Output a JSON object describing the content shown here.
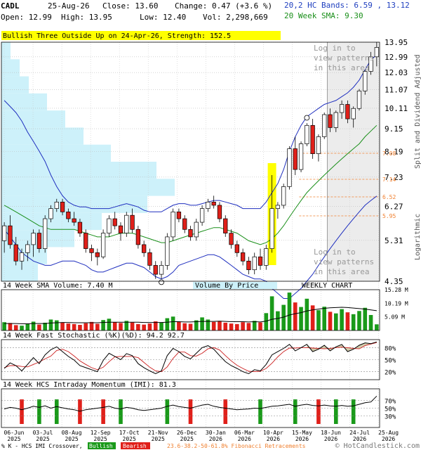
{
  "header": {
    "symbol": "CADL",
    "date": "25-Aug-26",
    "close": "Close: 13.60",
    "change": "Change: 0.47 (+3.6 %)",
    "open": "Open: 12.99",
    "high": "High: 13.95",
    "low": "Low: 12.40",
    "volume": "Vol: 2,298,669",
    "bands": "20,2 HC Bands: 6.59 , 13.12",
    "sma": "20 Week SMA: 9.30"
  },
  "banner": "Bullish Three Outside Up on 24-Apr-26, Strength: 152.5",
  "watermark": [
    "Log in to",
    "view patterns",
    "in this area"
  ],
  "colors": {
    "up": "#1a9a1a",
    "down": "#e0201a",
    "band": "#1f2fbf",
    "sma": "#1a8f1a",
    "vbp": "#cdf1fa",
    "highlight": "#ffff00",
    "shade": "#ececec",
    "fib": "#f08030"
  },
  "price_axis": {
    "labels": [
      "13.95",
      "12.99",
      "12.03",
      "11.07",
      "10.11",
      "9.15",
      "8.19",
      "7.23",
      "6.27",
      "5.31",
      "4.35"
    ],
    "title": "Split and Dividend Adjusted",
    "scale": "Logarithmic"
  },
  "fib_levels": [
    "7.08",
    "7.14",
    "6.52",
    "5.95"
  ],
  "panel_titles": {
    "volume": "14 Week SMA Volume: 7.40 M",
    "vbp": "Volume By Price",
    "weekly": "WEEKLY CHART",
    "stoch": "14 Week Fast Stochastic (%K)(%D): 94.2 92.7",
    "imi": "14 Week HCS Intraday Momentum (IMI): 81.3"
  },
  "volume_axis": [
    "15.28 M",
    "10.19 M",
    "5.09 M"
  ],
  "stoch_axis": [
    "80%",
    "50%",
    "20%"
  ],
  "imi_axis": [
    "70%",
    "50%",
    "30%"
  ],
  "x_labels": [
    [
      "06-Jun",
      "2025"
    ],
    [
      "03-Jul",
      "2025"
    ],
    [
      "08-Aug",
      "2025"
    ],
    [
      "12-Sep",
      "2025"
    ],
    [
      "17-Oct",
      "2025"
    ],
    [
      "21-Nov",
      "2025"
    ],
    [
      "26-Dec",
      "2025"
    ],
    [
      "30-Jan",
      "2026"
    ],
    [
      "06-Mar",
      "2026"
    ],
    [
      "10-Apr",
      "2026"
    ],
    [
      "15-May",
      "2026"
    ],
    [
      "18-Jun",
      "2026"
    ],
    [
      "24-Jul",
      "2026"
    ],
    [
      "25-Aug",
      "2026"
    ]
  ],
  "footer": {
    "prefix": "% K - HCS IMI Crossover,",
    "bullish": "Bullish",
    "bearish": "Bearish",
    "fib": "23.6-38.2-50-61.8% Fibonacci Retracements",
    "credit": "© HotCandlestick.com"
  },
  "chart_data": {
    "type": "candlestick",
    "title": "CADL",
    "ylim": [
      4.35,
      13.95
    ],
    "log_scale": true,
    "weeks": 65,
    "ohlc": [
      [
        5.3,
        5.8,
        5.0,
        5.7
      ],
      [
        5.7,
        6.0,
        5.1,
        5.2
      ],
      [
        5.2,
        5.4,
        4.7,
        4.8
      ],
      [
        4.8,
        5.1,
        4.6,
        5.0
      ],
      [
        5.0,
        5.3,
        4.8,
        5.2
      ],
      [
        5.2,
        5.6,
        4.9,
        5.5
      ],
      [
        5.5,
        5.6,
        5.0,
        5.1
      ],
      [
        5.1,
        6.0,
        5.0,
        5.9
      ],
      [
        5.9,
        6.3,
        5.8,
        6.2
      ],
      [
        6.2,
        6.5,
        6.1,
        6.4
      ],
      [
        6.4,
        6.5,
        6.0,
        6.1
      ],
      [
        6.1,
        6.2,
        5.8,
        5.9
      ],
      [
        5.9,
        6.1,
        5.7,
        5.8
      ],
      [
        5.8,
        5.9,
        5.4,
        5.5
      ],
      [
        5.5,
        5.6,
        5.0,
        5.1
      ],
      [
        5.1,
        5.2,
        4.8,
        5.0
      ],
      [
        5.0,
        5.1,
        4.7,
        4.9
      ],
      [
        4.9,
        5.6,
        4.85,
        5.5
      ],
      [
        5.5,
        6.0,
        5.4,
        5.9
      ],
      [
        5.9,
        6.1,
        5.6,
        5.7
      ],
      [
        5.7,
        5.8,
        5.3,
        5.5
      ],
      [
        5.5,
        6.1,
        5.4,
        6.0
      ],
      [
        6.0,
        6.2,
        5.5,
        5.6
      ],
      [
        5.6,
        5.7,
        5.1,
        5.2
      ],
      [
        5.2,
        5.3,
        4.9,
        5.0
      ],
      [
        5.0,
        5.1,
        4.6,
        4.7
      ],
      [
        4.7,
        4.8,
        4.4,
        4.5
      ],
      [
        4.5,
        4.8,
        4.4,
        4.7
      ],
      [
        4.7,
        5.5,
        4.6,
        5.4
      ],
      [
        5.4,
        6.2,
        5.3,
        6.1
      ],
      [
        6.1,
        6.2,
        5.8,
        5.9
      ],
      [
        5.9,
        6.0,
        5.5,
        5.6
      ],
      [
        5.6,
        5.7,
        5.3,
        5.4
      ],
      [
        5.4,
        5.9,
        5.3,
        5.8
      ],
      [
        5.8,
        6.3,
        5.7,
        6.2
      ],
      [
        6.2,
        6.5,
        6.1,
        6.4
      ],
      [
        6.4,
        6.6,
        6.2,
        6.3
      ],
      [
        6.3,
        6.4,
        5.8,
        5.9
      ],
      [
        5.9,
        6.0,
        5.4,
        5.5
      ],
      [
        5.5,
        5.6,
        5.1,
        5.2
      ],
      [
        5.2,
        5.3,
        4.9,
        5.0
      ],
      [
        5.0,
        5.1,
        4.7,
        4.8
      ],
      [
        4.8,
        4.9,
        4.5,
        4.6
      ],
      [
        4.6,
        5.0,
        4.5,
        4.9
      ],
      [
        4.9,
        5.1,
        4.6,
        4.7
      ],
      [
        4.7,
        5.2,
        4.6,
        5.1
      ],
      [
        5.1,
        7.3,
        5.0,
        6.2
      ],
      [
        6.2,
        6.4,
        5.9,
        6.3
      ],
      [
        6.3,
        7.0,
        6.2,
        6.9
      ],
      [
        6.9,
        8.4,
        6.8,
        8.3
      ],
      [
        8.3,
        8.8,
        7.3,
        7.5
      ],
      [
        7.5,
        8.6,
        7.4,
        8.5
      ],
      [
        8.5,
        9.4,
        8.4,
        9.3
      ],
      [
        9.3,
        9.6,
        7.9,
        8.1
      ],
      [
        8.1,
        8.9,
        7.8,
        8.8
      ],
      [
        8.8,
        9.9,
        8.7,
        9.8
      ],
      [
        9.8,
        10.1,
        9.0,
        9.2
      ],
      [
        9.2,
        10.0,
        9.0,
        9.9
      ],
      [
        9.9,
        10.5,
        9.6,
        10.3
      ],
      [
        10.3,
        10.5,
        9.4,
        9.6
      ],
      [
        9.6,
        10.2,
        9.2,
        10.1
      ],
      [
        10.1,
        11.1,
        10.0,
        11.0
      ],
      [
        11.0,
        12.2,
        10.8,
        12.1
      ],
      [
        12.1,
        13.3,
        11.9,
        12.99
      ],
      [
        12.99,
        13.95,
        12.4,
        13.6
      ]
    ],
    "volume_millions": [
      3.1,
      2.8,
      2.0,
      1.8,
      2.5,
      3.3,
      2.2,
      2.9,
      4.1,
      3.8,
      3.0,
      2.6,
      2.4,
      2.1,
      2.7,
      3.2,
      2.5,
      3.9,
      4.4,
      3.1,
      2.8,
      3.6,
      3.0,
      2.4,
      2.2,
      2.6,
      3.4,
      2.9,
      4.6,
      5.2,
      3.3,
      2.7,
      2.5,
      3.8,
      4.9,
      4.1,
      3.2,
      3.5,
      2.9,
      2.6,
      2.4,
      3.1,
      2.8,
      3.6,
      3.0,
      6.5,
      12.8,
      7.2,
      9.6,
      14.2,
      10.5,
      8.8,
      11.9,
      9.4,
      7.6,
      8.9,
      7.0,
      6.4,
      8.0,
      6.8,
      6.1,
      7.3,
      8.5,
      5.8,
      2.3
    ],
    "volume_sma": [
      2.6,
      2.6,
      2.6,
      2.5,
      2.5,
      2.6,
      2.6,
      2.6,
      2.8,
      2.9,
      3.0,
      3.0,
      2.9,
      2.9,
      2.9,
      2.9,
      2.9,
      3.0,
      3.1,
      3.1,
      3.1,
      3.1,
      3.1,
      3.1,
      3.0,
      3.0,
      3.0,
      3.0,
      3.1,
      3.3,
      3.3,
      3.2,
      3.2,
      3.3,
      3.4,
      3.4,
      3.4,
      3.5,
      3.4,
      3.3,
      3.3,
      3.3,
      3.2,
      3.3,
      3.2,
      3.5,
      4.2,
      4.5,
      5.0,
      5.8,
      6.3,
      6.7,
      7.3,
      7.7,
      8.0,
      8.3,
      8.5,
      8.6,
      8.7,
      8.6,
      8.4,
      8.2,
      8.0,
      7.7,
      7.4
    ],
    "stochastic_k": [
      28,
      42,
      35,
      22,
      38,
      55,
      40,
      62,
      75,
      82,
      70,
      58,
      49,
      35,
      30,
      25,
      20,
      48,
      66,
      58,
      50,
      65,
      60,
      40,
      30,
      22,
      15,
      22,
      60,
      78,
      70,
      58,
      52,
      66,
      80,
      85,
      76,
      60,
      45,
      35,
      28,
      20,
      15,
      25,
      22,
      38,
      62,
      70,
      78,
      88,
      72,
      80,
      88,
      70,
      76,
      86,
      72,
      82,
      88,
      70,
      76,
      86,
      92,
      90,
      94.2
    ],
    "stochastic_d": [
      30,
      35,
      35,
      33,
      32,
      38,
      44,
      52,
      59,
      73,
      76,
      70,
      59,
      47,
      38,
      30,
      25,
      31,
      45,
      57,
      58,
      58,
      58,
      55,
      43,
      31,
      22,
      20,
      32,
      53,
      69,
      69,
      60,
      59,
      66,
      77,
      80,
      74,
      60,
      47,
      36,
      28,
      21,
      20,
      21,
      28,
      41,
      57,
      70,
      79,
      79,
      80,
      80,
      79,
      78,
      77,
      78,
      80,
      81,
      80,
      78,
      77,
      85,
      89,
      92.7
    ],
    "imi": [
      48,
      52,
      50,
      46,
      50,
      55,
      52,
      56,
      50,
      54,
      51,
      48,
      46,
      42,
      46,
      48,
      50,
      52,
      55,
      50,
      48,
      52,
      50,
      46,
      44,
      46,
      48,
      50,
      55,
      58,
      54,
      52,
      50,
      54,
      58,
      60,
      55,
      52,
      50,
      48,
      46,
      47,
      48,
      50,
      49,
      52,
      55,
      56,
      58,
      60,
      55,
      58,
      60,
      57,
      56,
      58,
      56,
      55,
      57,
      55,
      56,
      60,
      64,
      66,
      81.3
    ],
    "band_upper": [
      10.5,
      10.2,
      9.9,
      9.5,
      9.0,
      8.6,
      8.2,
      7.8,
      7.3,
      6.9,
      6.6,
      6.4,
      6.3,
      6.25,
      6.25,
      6.2,
      6.2,
      6.2,
      6.2,
      6.25,
      6.3,
      6.35,
      6.3,
      6.25,
      6.15,
      6.1,
      6.1,
      6.1,
      6.2,
      6.3,
      6.35,
      6.35,
      6.3,
      6.3,
      6.35,
      6.4,
      6.45,
      6.45,
      6.4,
      6.35,
      6.3,
      6.2,
      6.2,
      6.2,
      6.2,
      6.4,
      6.7,
      7.0,
      7.5,
      8.2,
      8.8,
      9.3,
      9.7,
      9.9,
      10.1,
      10.3,
      10.4,
      10.5,
      10.7,
      10.9,
      11.2,
      11.6,
      12.2,
      12.8,
      13.12
    ],
    "band_lower": [
      5.6,
      5.4,
      5.2,
      5.0,
      4.9,
      4.8,
      4.75,
      4.7,
      4.7,
      4.75,
      4.8,
      4.8,
      4.8,
      4.75,
      4.7,
      4.6,
      4.55,
      4.55,
      4.6,
      4.65,
      4.7,
      4.75,
      4.75,
      4.7,
      4.65,
      4.55,
      4.45,
      4.4,
      4.45,
      4.55,
      4.7,
      4.75,
      4.8,
      4.85,
      4.9,
      4.95,
      4.95,
      4.9,
      4.8,
      4.7,
      4.6,
      4.5,
      4.45,
      4.4,
      4.4,
      4.35,
      4.2,
      4.1,
      4.0,
      4.0,
      4.1,
      4.2,
      4.35,
      4.5,
      4.7,
      4.9,
      5.1,
      5.3,
      5.5,
      5.7,
      5.9,
      6.1,
      6.3,
      6.45,
      6.59
    ],
    "sma20": [
      6.3,
      6.2,
      6.1,
      6.0,
      5.9,
      5.8,
      5.7,
      5.65,
      5.6,
      5.6,
      5.6,
      5.6,
      5.6,
      5.55,
      5.5,
      5.45,
      5.4,
      5.4,
      5.4,
      5.45,
      5.5,
      5.5,
      5.5,
      5.45,
      5.4,
      5.35,
      5.3,
      5.25,
      5.25,
      5.3,
      5.35,
      5.4,
      5.45,
      5.5,
      5.55,
      5.6,
      5.65,
      5.65,
      5.6,
      5.55,
      5.5,
      5.4,
      5.3,
      5.25,
      5.2,
      5.25,
      5.35,
      5.5,
      5.7,
      5.95,
      6.2,
      6.45,
      6.7,
      6.9,
      7.1,
      7.3,
      7.5,
      7.7,
      7.9,
      8.1,
      8.3,
      8.5,
      8.8,
      9.05,
      9.3
    ],
    "vbp": [
      0.2,
      0.25,
      0.4,
      0.55,
      0.8,
      0.95,
      0.85,
      0.6,
      0.45,
      0.35,
      0.25,
      0.15,
      0.1,
      0.05
    ]
  }
}
